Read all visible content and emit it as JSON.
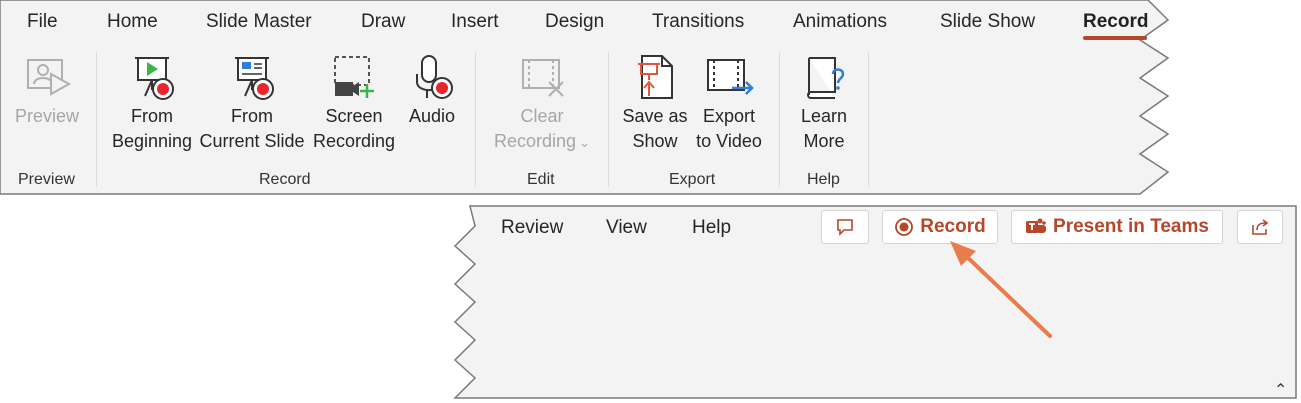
{
  "ribbon": {
    "tabs": [
      {
        "label": "File"
      },
      {
        "label": "Home"
      },
      {
        "label": "Slide Master"
      },
      {
        "label": "Draw"
      },
      {
        "label": "Insert"
      },
      {
        "label": "Design"
      },
      {
        "label": "Transitions"
      },
      {
        "label": "Animations"
      },
      {
        "label": "Slide Show"
      },
      {
        "label": "Record"
      }
    ],
    "active_tab": "Record",
    "accent_color": "#b7472a",
    "tools": {
      "preview": {
        "label": "Preview",
        "icon": "preview-icon",
        "enabled": false
      },
      "from_beginning": {
        "line1": "From",
        "line2": "Beginning",
        "icon": "record-from-beginning-icon"
      },
      "from_current": {
        "line1": "From",
        "line2": "Current Slide",
        "icon": "record-from-current-slide-icon"
      },
      "screen_recording": {
        "line1": "Screen",
        "line2": "Recording",
        "icon": "screen-recording-icon"
      },
      "audio": {
        "label": "Audio",
        "icon": "audio-record-icon"
      },
      "clear_recording": {
        "line1": "Clear",
        "line2": "Recording",
        "icon": "clear-recording-icon",
        "enabled": false
      },
      "save_as_show": {
        "line1": "Save as",
        "line2": "Show",
        "icon": "save-as-show-icon"
      },
      "export_video": {
        "line1": "Export",
        "line2": "to Video",
        "icon": "export-video-icon"
      },
      "learn_more": {
        "line1": "Learn",
        "line2": "More",
        "icon": "help-book-icon"
      }
    },
    "groups": {
      "preview": "Preview",
      "record": "Record",
      "edit": "Edit",
      "export": "Export",
      "help": "Help"
    }
  },
  "ribbon_right": {
    "tabs": [
      {
        "label": "Review"
      },
      {
        "label": "View"
      },
      {
        "label": "Help"
      }
    ],
    "comment_icon": "comment-icon",
    "record_button": {
      "label": "Record",
      "icon": "record-circle-icon"
    },
    "teams_button": {
      "label": "Present in Teams",
      "icon": "teams-icon"
    },
    "share_icon": "share-icon",
    "collapse_icon": "chevron-up-icon"
  },
  "annotation": {
    "arrow_color": "#ea7b4b",
    "arrow_target": "record-button"
  }
}
